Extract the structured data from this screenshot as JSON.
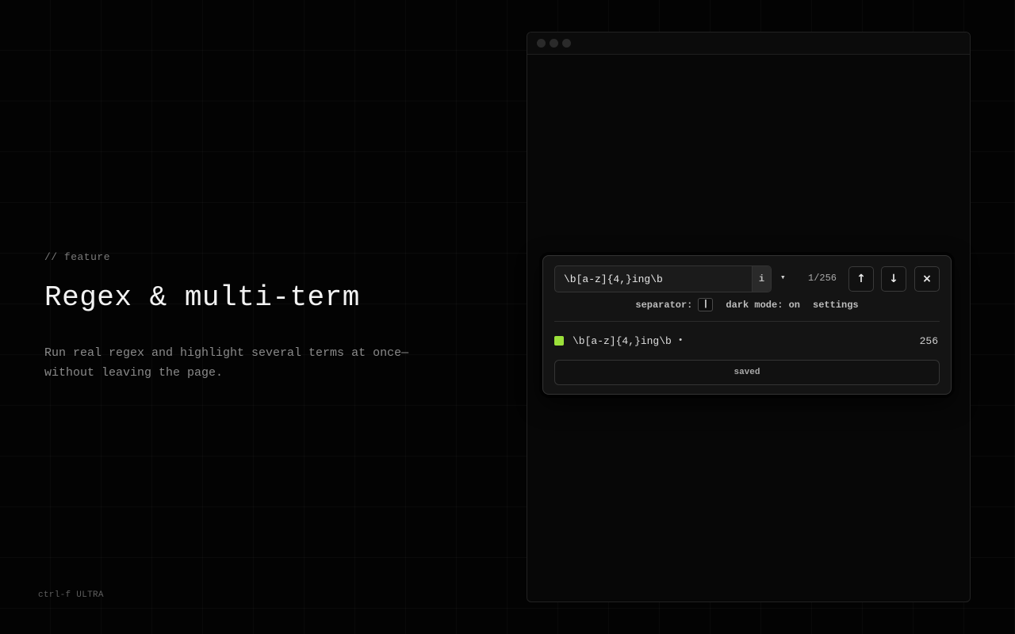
{
  "page": {
    "eyebrow": "// feature",
    "headline": "Regex & multi-term",
    "description": "Run real regex and highlight several terms at once—without leaving the page.",
    "brand": "ctrl-f ULTRA"
  },
  "find_panel": {
    "search_value": "\\b[a-z]{4,}ing\\b",
    "case_toggle_label": "i",
    "dropdown_icon": "▾",
    "match_count": "1/256",
    "prev_icon": "↑",
    "next_icon": "↓",
    "close_icon": "×",
    "options": {
      "separator_label": "separator:",
      "separator_value": "|",
      "dark_mode_label": "dark mode: on",
      "settings_label": "settings"
    },
    "terms": [
      {
        "pattern": "\\b[a-z]{4,}ing\\b",
        "marker": "•",
        "count": "256",
        "color": "#9be03a"
      }
    ],
    "saved_label": "saved"
  },
  "colors": {
    "background": "#030303",
    "panel": "#141414",
    "accent_green": "#9be03a"
  }
}
